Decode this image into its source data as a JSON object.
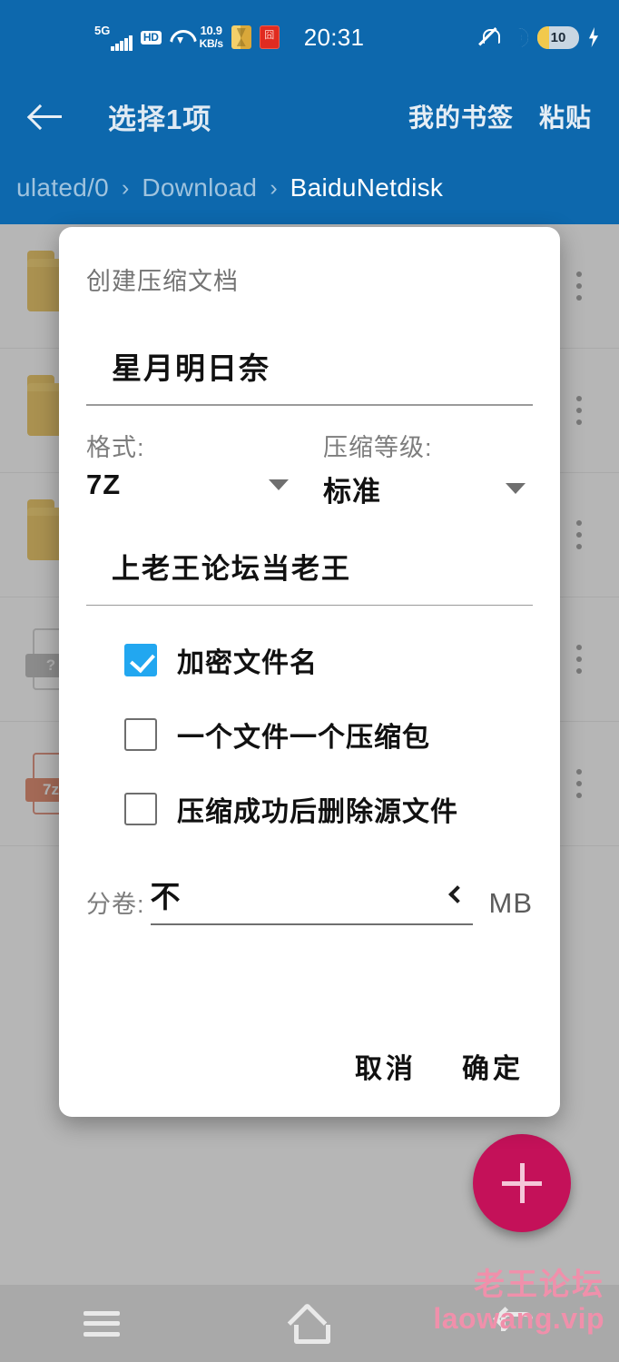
{
  "status_bar": {
    "network_type": "5G",
    "hd_label": "HD",
    "data_speed_value": "10.9",
    "data_speed_unit": "KB/s",
    "clock": "20:31",
    "battery_percent": "10",
    "icons": [
      "signal-bars-icon",
      "hd-icon",
      "wifi-icon",
      "app-icon-yellow",
      "app-icon-red",
      "mute-bell-icon",
      "moon-dnd-icon",
      "battery-icon",
      "charging-bolt-icon"
    ],
    "accent_color": "#0d68ad"
  },
  "app_bar": {
    "back_label": "back",
    "selection_title": "选择1项",
    "actions": [
      {
        "label": "我的书签"
      },
      {
        "label": "粘贴"
      }
    ],
    "breadcrumb": [
      {
        "label": "ulated/0",
        "current": false
      },
      {
        "label": "Download",
        "current": false
      },
      {
        "label": "BaiduNetdisk",
        "current": true
      }
    ],
    "separator": "›"
  },
  "file_list": {
    "rows": [
      {
        "icon": "folder-icon",
        "name": "",
        "sub": ""
      },
      {
        "icon": "folder-icon",
        "name": "",
        "sub": ""
      },
      {
        "icon": "folder-icon",
        "name": "",
        "sub": ""
      },
      {
        "icon": "unknown-file-icon",
        "name": "",
        "sub": "",
        "badge": "?"
      },
      {
        "icon": "archive-7z-icon",
        "name": "",
        "sub": "",
        "badge": "7z"
      }
    ],
    "overflow_icon": "more-vertical-icon"
  },
  "fab": {
    "icon": "plus-icon",
    "color": "#c41159"
  },
  "watermark": {
    "line1": "老王论坛",
    "line2": "laowang.vip",
    "color": "#f090ab"
  },
  "nav_bar": {
    "recents_label": "recents",
    "home_label": "home",
    "back_label": "back"
  },
  "dialog": {
    "title": "创建压缩文档",
    "archive_name": "星月明日奈",
    "format": {
      "label": "格式:",
      "value": "7Z"
    },
    "level": {
      "label": "压缩等级:",
      "value": "标准"
    },
    "password": "上老王论坛当老王",
    "checkboxes": [
      {
        "label": "加密文件名",
        "checked": true
      },
      {
        "label": "一个文件一个压缩包",
        "checked": false
      },
      {
        "label": "压缩成功后删除源文件",
        "checked": false
      }
    ],
    "split": {
      "label": "分卷:",
      "value": "不",
      "unit": "MB"
    },
    "buttons": {
      "cancel": "取消",
      "confirm": "确定"
    },
    "checkbox_accent": "#22a7f0"
  }
}
